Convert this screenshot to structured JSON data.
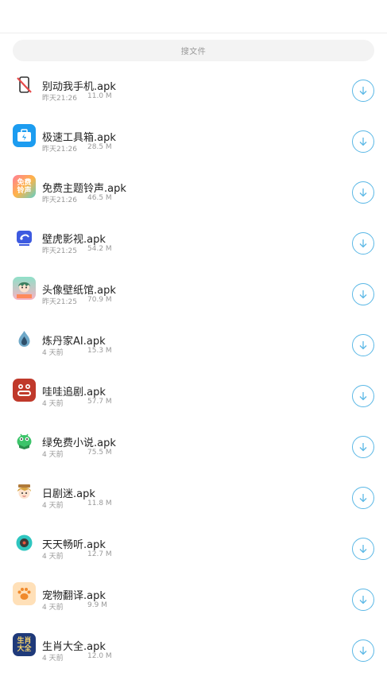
{
  "search": {
    "placeholder": "搜文件"
  },
  "files": [
    {
      "name": "别动我手机.apk",
      "time": "昨天21:26",
      "size": "11.0 M",
      "icon": "no-phone-icon"
    },
    {
      "name": "极速工具箱.apk",
      "time": "昨天21:26",
      "size": "28.5 M",
      "icon": "toolbox-icon"
    },
    {
      "name": "免费主题铃声.apk",
      "time": "昨天21:26",
      "size": "46.5 M",
      "icon": "ringtone-app-icon",
      "icon_text": "免费\n铃声"
    },
    {
      "name": "壁虎影视.apk",
      "time": "昨天21:25",
      "size": "54.2 M",
      "icon": "gecko-video-icon"
    },
    {
      "name": "头像壁纸馆.apk",
      "time": "昨天21:25",
      "size": "70.9 M",
      "icon": "avatar-wallpaper-icon"
    },
    {
      "name": "炼丹家AI.apk",
      "time": "4 天前",
      "size": "15.3 M",
      "icon": "ai-flame-icon"
    },
    {
      "name": "哇哇追剧.apk",
      "time": "4 天前",
      "size": "57.7 M",
      "icon": "wawa-drama-icon"
    },
    {
      "name": "绿免费小说.apk",
      "time": "4 天前",
      "size": "75.5 M",
      "icon": "green-novel-icon"
    },
    {
      "name": "日剧迷.apk",
      "time": "4 天前",
      "size": "11.8 M",
      "icon": "jdrama-fan-icon"
    },
    {
      "name": "天天畅听.apk",
      "time": "4 天前",
      "size": "12.7 M",
      "icon": "daily-listen-icon"
    },
    {
      "name": "宠物翻译.apk",
      "time": "4 天前",
      "size": "9.9 M",
      "icon": "paw-icon"
    },
    {
      "name": "生肖大全.apk",
      "time": "4 天前",
      "size": "12.0 M",
      "icon": "zodiac-icon",
      "icon_text": "生肖\n大全"
    }
  ],
  "colors": {
    "accent": "#5bb8e6",
    "text_primary": "#222222",
    "text_secondary": "#999999"
  }
}
